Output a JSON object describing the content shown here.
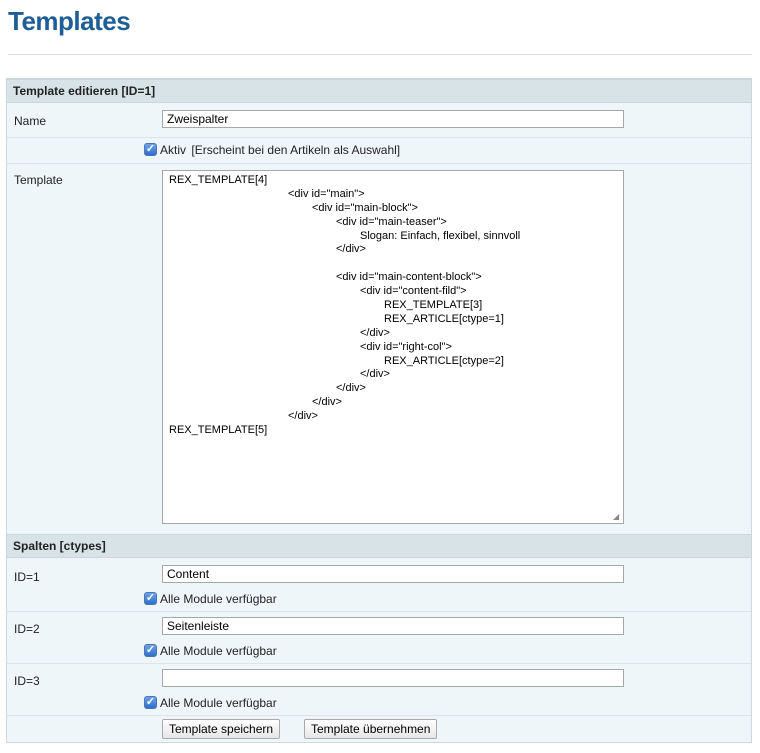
{
  "page": {
    "title": "Templates"
  },
  "edit_section": {
    "header": "Template editieren [ID=1]",
    "name_label": "Name",
    "name_value": "Zweispalter",
    "active_checked": true,
    "active_label": "Aktiv",
    "active_hint": "[Erscheint bei den Artikeln als Auswahl]",
    "template_label": "Template",
    "template_code": [
      {
        "indent": 0,
        "text": "REX_TEMPLATE[4]"
      },
      {
        "indent": 1,
        "text": "<div id=\"main\">"
      },
      {
        "indent": 2,
        "text": "<div id=\"main-block\">"
      },
      {
        "indent": 3,
        "text": "<div id=\"main-teaser\">"
      },
      {
        "indent": 4,
        "text": "Slogan: Einfach, flexibel, sinnvoll"
      },
      {
        "indent": 3,
        "text": "</div>"
      },
      {
        "indent": 0,
        "text": ""
      },
      {
        "indent": 3,
        "text": "<div id=\"main-content-block\">"
      },
      {
        "indent": 4,
        "text": "<div id=\"content-fild\">"
      },
      {
        "indent": 5,
        "text": "REX_TEMPLATE[3]"
      },
      {
        "indent": 5,
        "text": "REX_ARTICLE[ctype=1]"
      },
      {
        "indent": 4,
        "text": "</div>"
      },
      {
        "indent": 4,
        "text": "<div id=\"right-col\">"
      },
      {
        "indent": 5,
        "text": "REX_ARTICLE[ctype=2]"
      },
      {
        "indent": 4,
        "text": "</div>"
      },
      {
        "indent": 3,
        "text": "</div>"
      },
      {
        "indent": 2,
        "text": "</div>"
      },
      {
        "indent": 1,
        "text": "</div>"
      },
      {
        "indent": 0,
        "text": "REX_TEMPLATE[5]"
      }
    ]
  },
  "ctypes_section": {
    "header": "Spalten [ctypes]",
    "items": [
      {
        "label": "ID=1",
        "value": "Content",
        "all_modules_checked": true,
        "all_modules_label": "Alle Module verfügbar"
      },
      {
        "label": "ID=2",
        "value": "Seitenleiste",
        "all_modules_checked": true,
        "all_modules_label": "Alle Module verfügbar"
      },
      {
        "label": "ID=3",
        "value": "",
        "all_modules_checked": true,
        "all_modules_label": "Alle Module verfügbar"
      }
    ]
  },
  "buttons": {
    "save_label": "Template speichern",
    "apply_label": "Template übernehmen"
  }
}
